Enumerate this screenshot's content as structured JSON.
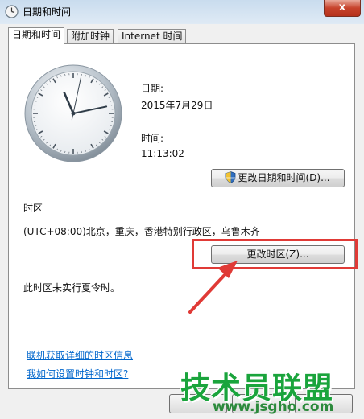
{
  "window": {
    "title": "日期和时间",
    "close_label": "x"
  },
  "tabs": [
    {
      "label": "日期和时间",
      "active": true
    },
    {
      "label": "附加时钟",
      "active": false
    },
    {
      "label": "Internet 时间",
      "active": false
    }
  ],
  "clock": {
    "time_shown": "11:13:02",
    "hour": 11,
    "minute": 13,
    "second": 2
  },
  "date_section": {
    "date_label": "日期:",
    "date_value": "2015年7月29日",
    "time_label": "时间:",
    "time_value": "11:13:02",
    "change_datetime_button": "更改日期和时间(D)..."
  },
  "timezone_section": {
    "heading": "时区",
    "timezone_value": "(UTC+08:00)北京，重庆，香港特别行政区，乌鲁木齐",
    "change_timezone_button": "更改时区(Z)...",
    "dst_note": "此时区未实行夏令时。"
  },
  "links": {
    "online_tz_info": "联机获取详细的时区信息",
    "how_to_set": "我如何设置时钟和时区?"
  },
  "watermark": {
    "title": "技术员联盟",
    "url": "www.jsgho.com"
  },
  "colors": {
    "highlight": "#e03a36",
    "link": "#0066cc",
    "watermark_green": "#1aa43c"
  }
}
